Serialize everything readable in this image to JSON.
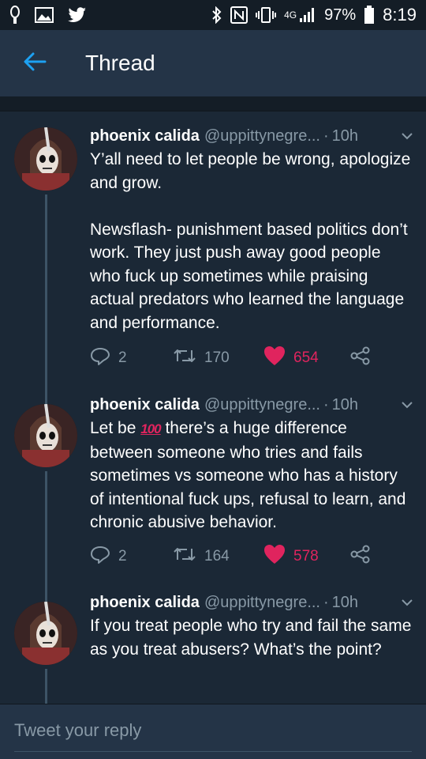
{
  "status_bar": {
    "battery": "97%",
    "time": "8:19",
    "network": "4G"
  },
  "header": {
    "title": "Thread",
    "back_icon": "arrow-left-icon"
  },
  "colors": {
    "accent": "#1da1f2",
    "like": "#e0245e",
    "secondary_text": "#8899a6",
    "background": "#1b2836",
    "header_bg": "#243447"
  },
  "tweets": [
    {
      "name": "phoenix calida",
      "handle": "@uppittynegre...",
      "time": "10h",
      "text": "Y’all need to let people be wrong, apologize and grow.\n\nNewsflash- punishment based politics don’t work. They just push away good people who fuck up sometimes while praising actual predators who learned the language and performance.",
      "replies": "2",
      "retweets": "170",
      "likes": "654"
    },
    {
      "name": "phoenix calida",
      "handle": "@uppittynegre...",
      "time": "10h",
      "text_before": "Let be ",
      "emoji": "100",
      "text_after": " there’s a huge difference between someone who tries and fails sometimes vs someone who has a history of intentional fuck ups, refusal to learn, and chronic abusive behavior.",
      "replies": "2",
      "retweets": "164",
      "likes": "578"
    },
    {
      "name": "phoenix calida",
      "handle": "@uppittynegre...",
      "time": "10h",
      "text": "If you treat people who try and fail the same as you treat abusers? What’s the point?"
    }
  ],
  "reply": {
    "placeholder": "Tweet your reply"
  }
}
